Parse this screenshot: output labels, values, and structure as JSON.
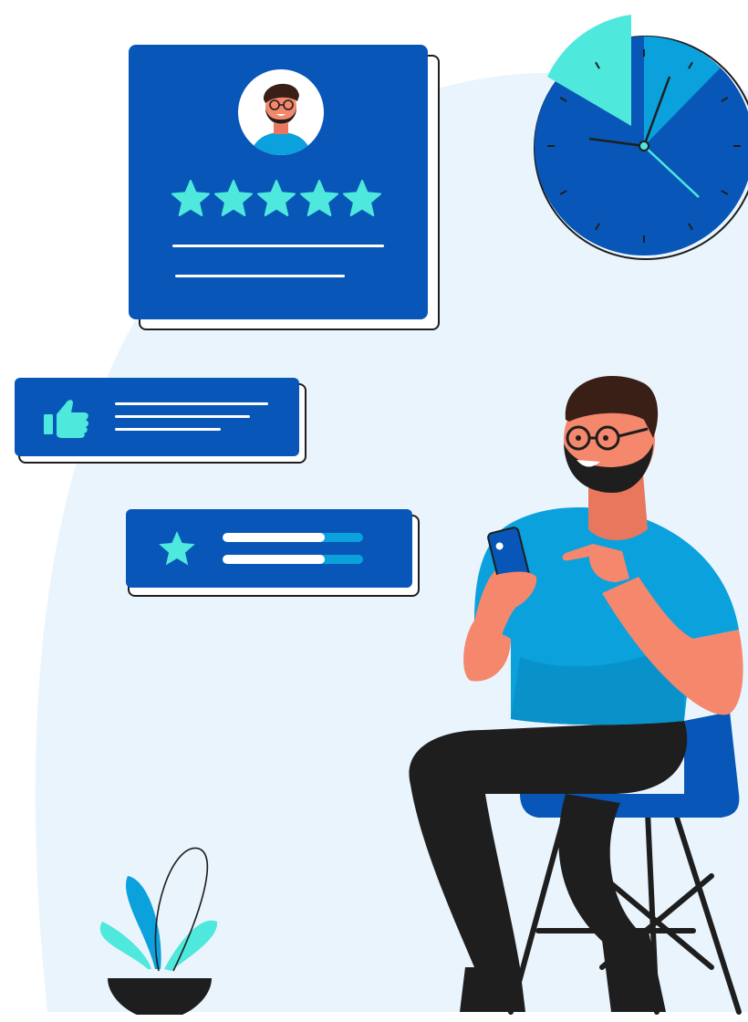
{
  "illustration": {
    "review_card": {
      "star_rating": 5,
      "star_max": 5
    },
    "rating_card": {
      "progress_fraction": 0.73
    },
    "clock": {
      "highlighted_fraction": 0.14
    },
    "colors": {
      "primary_blue": "#0857b8",
      "accent_teal": "#4ee8dc",
      "sky_blue": "#0aa1dd",
      "background_tint": "#eaf4fc",
      "skin": "#f4876c",
      "hair": "#3a1f16",
      "pants": "#1e1e1e"
    },
    "icons": [
      "user-avatar",
      "star-icon",
      "thumbs-up-icon",
      "clock-icon",
      "smartphone-icon",
      "plant-icon"
    ]
  }
}
